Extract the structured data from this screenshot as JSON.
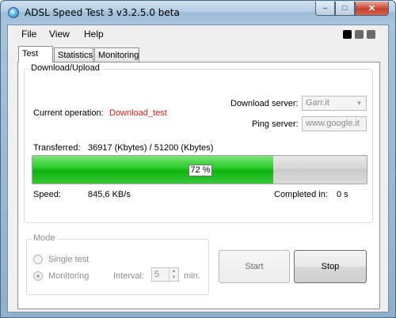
{
  "window": {
    "title": "ADSL Speed Test 3 v3.2.5.0 beta",
    "buttons": {
      "minimize": "–",
      "maximize": "□",
      "close": "✕"
    }
  },
  "menu": {
    "file": "File",
    "view": "View",
    "help": "Help"
  },
  "indicator_colors": [
    "#000000",
    "#6b6b6b",
    "#6b6b6b"
  ],
  "tabs": [
    {
      "label": "Test",
      "active": true
    },
    {
      "label": "Statistics",
      "active": false
    },
    {
      "label": "Monitoring",
      "active": false
    }
  ],
  "download_upload": {
    "title": "Download/Upload",
    "current_operation_label": "Current operation:",
    "current_operation_value": "Download_test",
    "current_operation_color": "#e0201c",
    "download_server_label": "Download server:",
    "download_server_value": "Garr.it",
    "ping_server_label": "Ping server:",
    "ping_server_value": "www.google.it",
    "transferred_label": "Transferred:",
    "transferred_value": "36917 (Kbytes) / 51200 (Kbytes)",
    "progress_percent": 72,
    "progress_text": "72 %",
    "speed_label": "Speed:",
    "speed_value": "845,6 KB/s",
    "completed_label": "Completed in:",
    "completed_value": "0 s"
  },
  "mode": {
    "title": "Mode",
    "single_label": "Single test",
    "monitoring_label": "Monitoring",
    "interval_label": "Interval:",
    "interval_value": "5",
    "interval_unit": "min."
  },
  "actions": {
    "start": "Start",
    "stop": "Stop"
  }
}
